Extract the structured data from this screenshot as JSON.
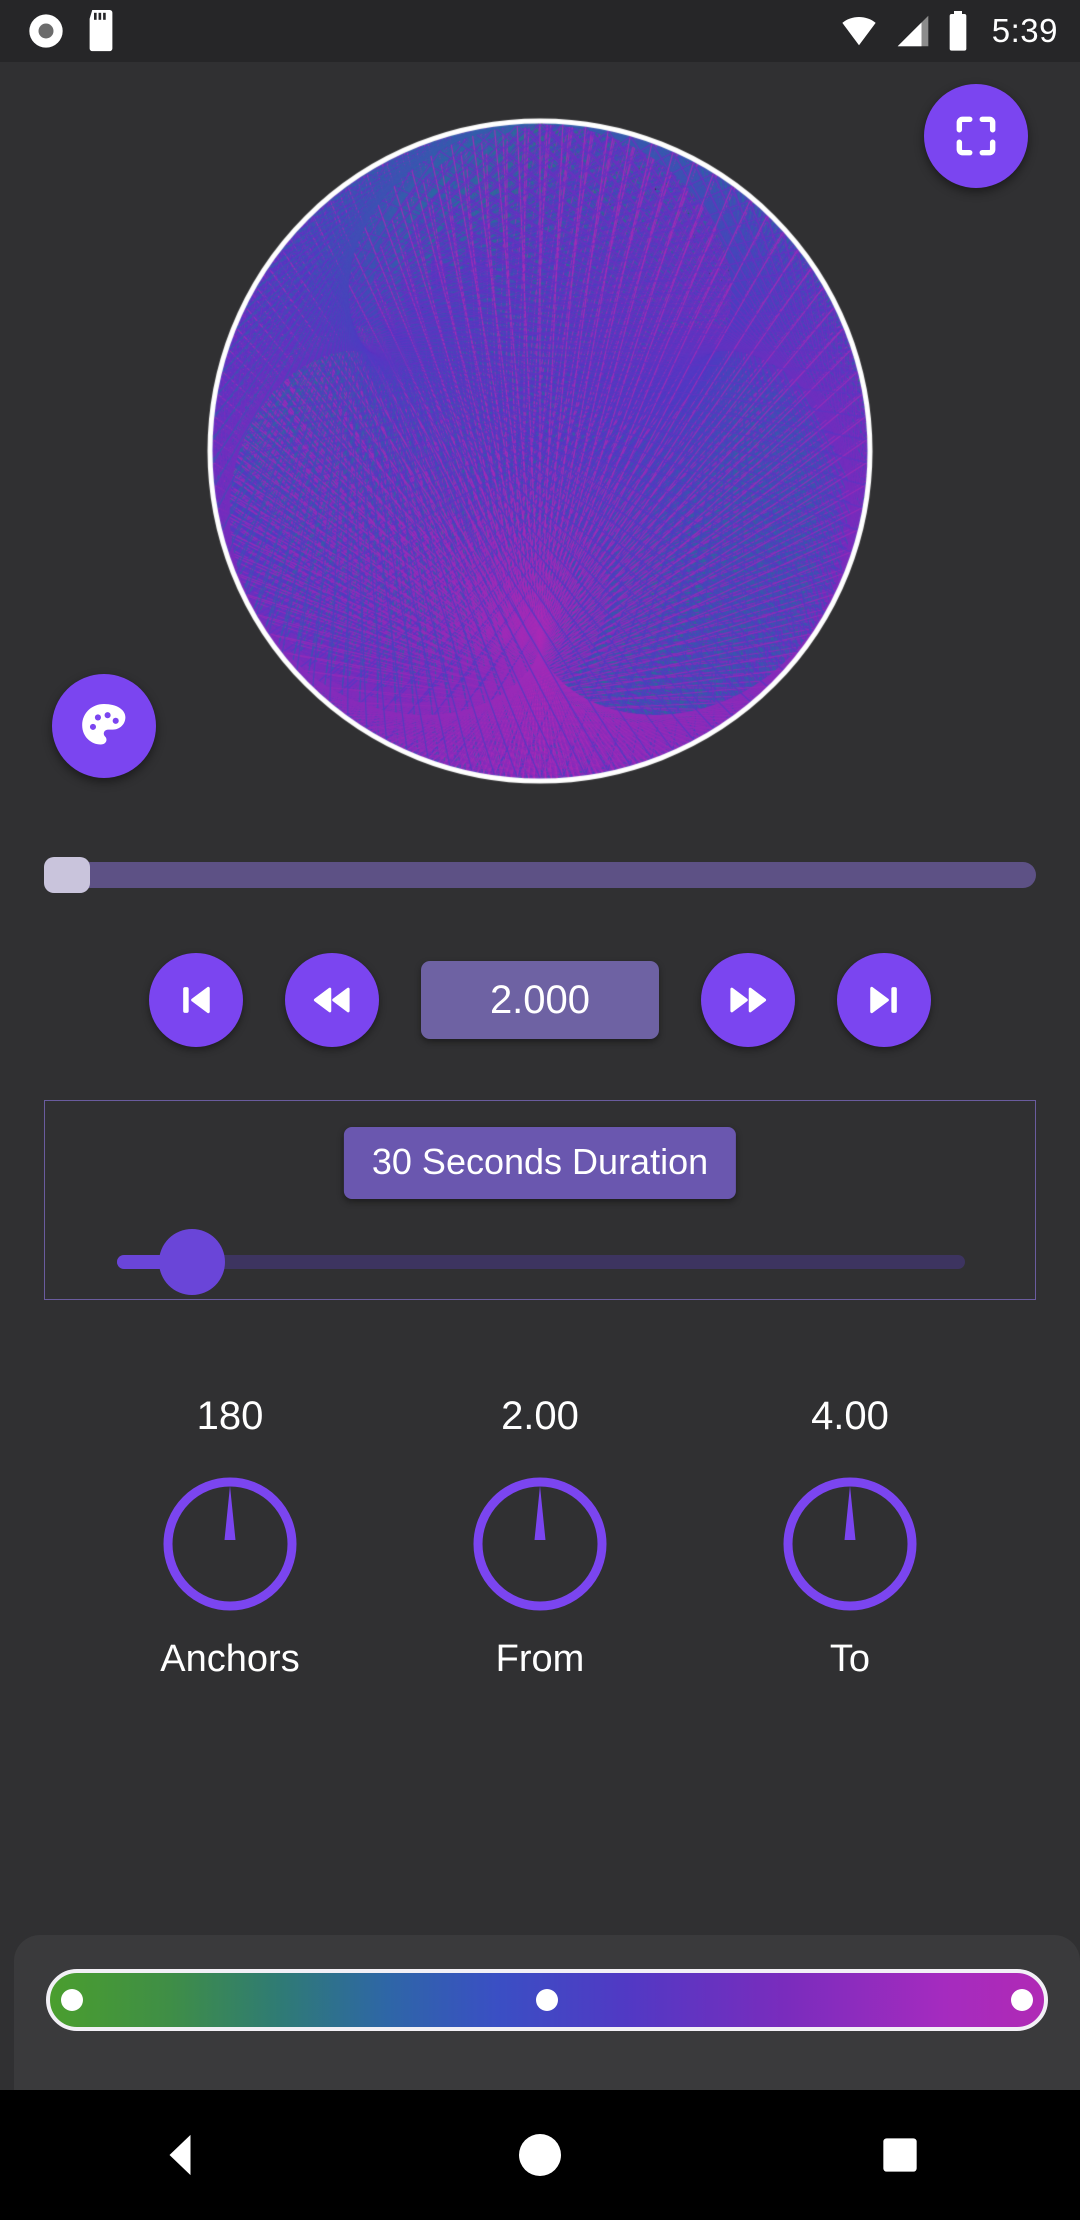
{
  "statusbar": {
    "time": "5:39",
    "icons": [
      "screen-record-icon",
      "sd-card-icon",
      "wifi-icon",
      "cell-signal-icon",
      "battery-icon"
    ]
  },
  "canvas": {
    "name": "string-art-visualization",
    "description": "Modular multiplication string art inside a white circle",
    "circle_color": "#FFFFFF",
    "background": "#303032"
  },
  "fabs": {
    "fullscreen": {
      "icon": "fullscreen-icon",
      "color": "#7B45F0"
    },
    "palette": {
      "icon": "palette-icon",
      "color": "#7B45F0"
    }
  },
  "seek": {
    "name": "playback-seek-bar",
    "value_percent": 0,
    "track_color": "#5D5185",
    "thumb_color": "#C9C4DC"
  },
  "transport": {
    "skip_previous": "skip-previous-icon",
    "rewind": "rewind-icon",
    "value": "2.000",
    "fast_forward": "fast-forward-icon",
    "skip_next": "skip-next-icon"
  },
  "duration": {
    "button_label": "30 Seconds Duration",
    "slider_percent": 7,
    "accent": "#6A45D8"
  },
  "knobs": [
    {
      "value": "180",
      "label": "Anchors",
      "angle_deg": 0,
      "color": "#7B45F0"
    },
    {
      "value": "2.00",
      "label": "From",
      "angle_deg": 0,
      "color": "#7B45F0"
    },
    {
      "value": "4.00",
      "label": "To",
      "angle_deg": 0,
      "color": "#7B45F0"
    }
  ],
  "gradient": {
    "name": "color-gradient-picker",
    "stops": [
      {
        "position_percent": 2,
        "color": "#4A9E2E"
      },
      {
        "position_percent": 50,
        "color": "#3A4FC4"
      },
      {
        "position_percent": 98,
        "color": "#A52BBF"
      }
    ],
    "border_color": "#F2F0F6",
    "panel_color": "#3A3A3C"
  },
  "navbar": {
    "back": "back-triangle-icon",
    "home": "home-circle-icon",
    "recents": "recents-square-icon"
  }
}
